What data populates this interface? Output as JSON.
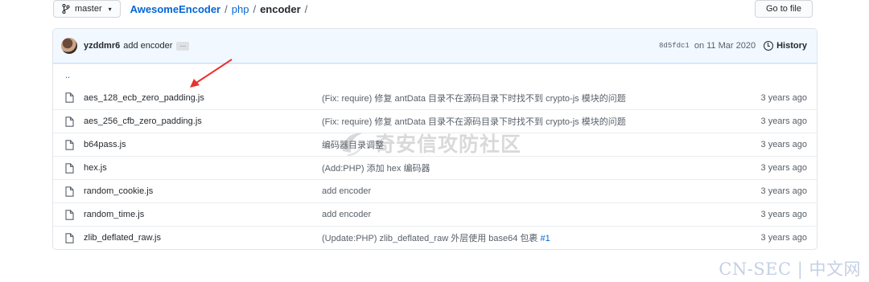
{
  "branch": {
    "label": "master",
    "icon": "git-branch-icon"
  },
  "breadcrumb": {
    "repo": "AwesomeEncoder",
    "sep1": "/",
    "folder": "php",
    "sep2": "/",
    "current": "encoder",
    "sep3": "/"
  },
  "goto_file": "Go to file",
  "commit": {
    "author": "yzddmr6",
    "message": "add encoder",
    "ellipsis": "…",
    "sha": "8d5fdc1",
    "date": "on 11 Mar 2020",
    "history": "History"
  },
  "updir": "..",
  "files": [
    {
      "name": "aes_128_ecb_zero_padding.js",
      "message": "(Fix: require) 修复 antData 目录不在源码目录下时找不到 crypto-js 模块的问题",
      "age": "3 years ago"
    },
    {
      "name": "aes_256_cfb_zero_padding.js",
      "message": "(Fix: require) 修复 antData 目录不在源码目录下时找不到 crypto-js 模块的问题",
      "age": "3 years ago"
    },
    {
      "name": "b64pass.js",
      "message": "编码器目录调整",
      "age": "3 years ago"
    },
    {
      "name": "hex.js",
      "message": "(Add:PHP) 添加 hex 编码器",
      "age": "3 years ago"
    },
    {
      "name": "random_cookie.js",
      "message": "add encoder",
      "age": "3 years ago"
    },
    {
      "name": "random_time.js",
      "message": "add encoder",
      "age": "3 years ago"
    },
    {
      "name": "zlib_deflated_raw.js",
      "message": "(Update:PHP) zlib_deflated_raw 外层使用 base64 包裹",
      "pr": "#1",
      "age": "3 years ago"
    }
  ],
  "watermark": "奇安信攻防社区",
  "footer_mark": "CN-SEC | 中文网",
  "colors": {
    "link": "#0366d6",
    "annotation_arrow": "#e8322d",
    "commit_bar": "#f1f8ff"
  }
}
